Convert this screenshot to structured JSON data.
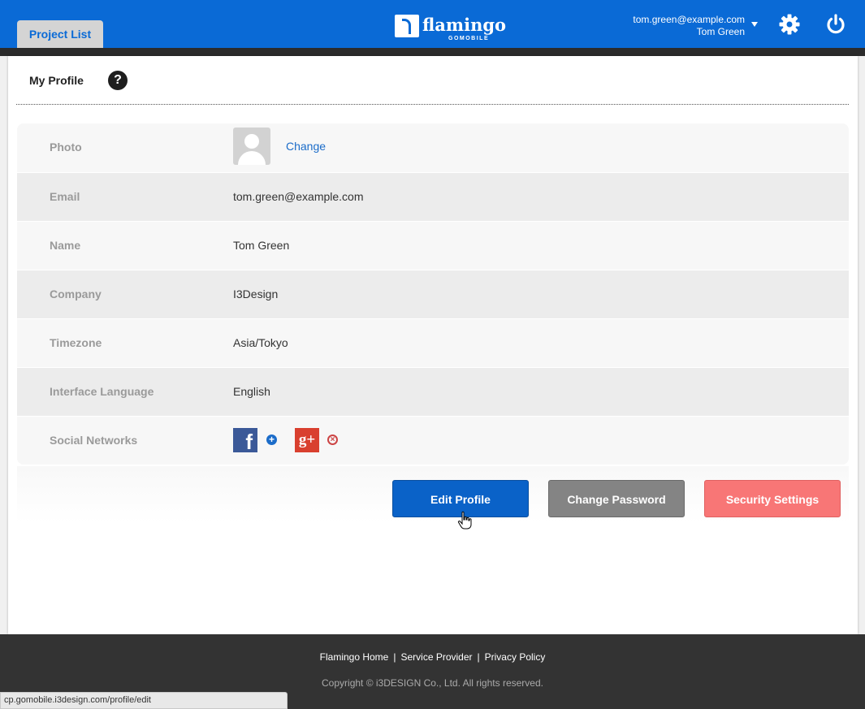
{
  "header": {
    "tab_label": "Project List",
    "logo_text": "flamingo",
    "logo_subtext": "GOMOBILE",
    "user_email": "tom.green@example.com",
    "user_name": "Tom Green",
    "accent_color": "#0a6ad6"
  },
  "page": {
    "title": "My Profile",
    "help_icon": "?"
  },
  "profile": {
    "photo_label": "Photo",
    "photo_change_link": "Change",
    "rows": [
      {
        "label": "Email",
        "value": "tom.green@example.com"
      },
      {
        "label": "Name",
        "value": "Tom Green"
      },
      {
        "label": "Company",
        "value": "I3Design"
      },
      {
        "label": "Timezone",
        "value": "Asia/Tokyo"
      },
      {
        "label": "Interface Language",
        "value": "English"
      }
    ],
    "social_label": "Social Networks",
    "social": {
      "facebook_glyph": "f",
      "googleplus_glyph": "g+",
      "add_glyph": "+",
      "remove_glyph": "×"
    }
  },
  "actions": {
    "edit_profile": "Edit Profile",
    "change_password": "Change Password",
    "security_settings": "Security Settings"
  },
  "footer": {
    "links": [
      "Flamingo Home",
      "Service Provider",
      "Privacy Policy"
    ],
    "separator": "|",
    "copyright": "Copyright © i3DESIGN Co., Ltd. All rights reserved."
  },
  "status_bar": {
    "url": "cp.gomobile.i3design.com/profile/edit"
  }
}
